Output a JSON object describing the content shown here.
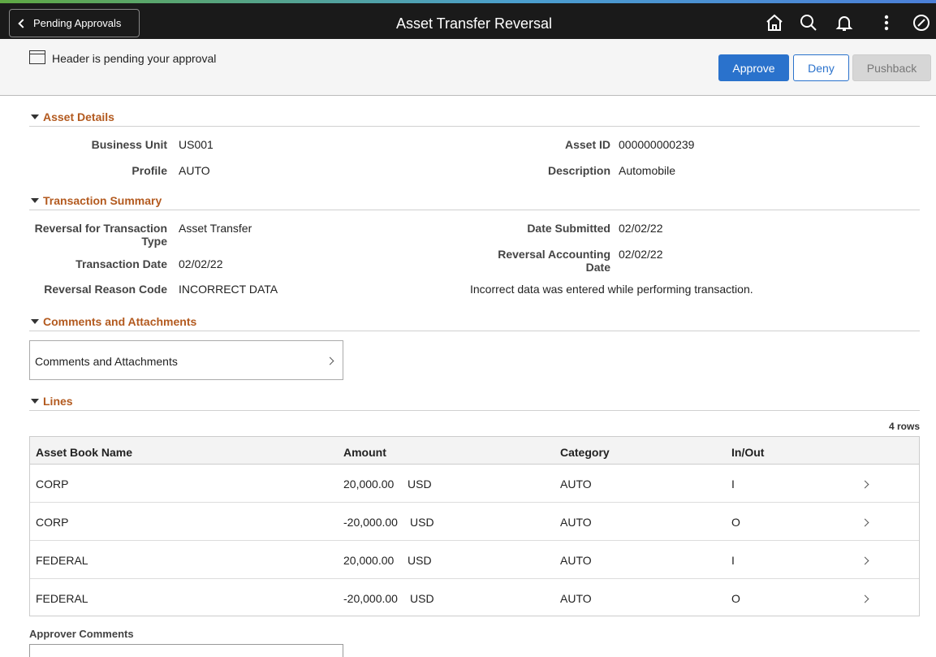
{
  "header": {
    "back_label": "Pending Approvals",
    "title": "Asset Transfer Reversal",
    "icons": [
      "home-icon",
      "search-icon",
      "bell-icon",
      "more-vertical-icon",
      "nav-compass-icon"
    ]
  },
  "subheader": {
    "pending_text": "Header is pending your approval",
    "approve_label": "Approve",
    "deny_label": "Deny",
    "pushback_label": "Pushback"
  },
  "asset_details": {
    "title": "Asset Details",
    "business_unit_label": "Business Unit",
    "business_unit": "US001",
    "asset_id_label": "Asset ID",
    "asset_id": "000000000239",
    "profile_label": "Profile",
    "profile": "AUTO",
    "description_label": "Description",
    "description": "Automobile"
  },
  "transaction_summary": {
    "title": "Transaction Summary",
    "reversal_type_label_1": "Reversal for Transaction",
    "reversal_type_label_2": "Type",
    "reversal_type": "Asset Transfer",
    "date_submitted_label": "Date Submitted",
    "date_submitted": "02/02/22",
    "transaction_date_label": "Transaction Date",
    "transaction_date": "02/02/22",
    "reversal_acct_date_label_1": "Reversal Accounting",
    "reversal_acct_date_label_2": "Date",
    "reversal_acct_date": "02/02/22",
    "reason_code_label": "Reversal Reason Code",
    "reason_code": "INCORRECT DATA",
    "reason_description": "Incorrect data was entered while performing transaction."
  },
  "comments": {
    "title": "Comments and Attachments",
    "link_label": "Comments and Attachments"
  },
  "lines": {
    "title": "Lines",
    "row_count": "4 rows",
    "columns": [
      "Asset Book Name",
      "Amount",
      "Category",
      "In/Out"
    ],
    "rows": [
      {
        "book": "CORP",
        "amount": "20,000.00",
        "currency": "USD",
        "category": "AUTO",
        "inout": "I"
      },
      {
        "book": "CORP",
        "amount": "-20,000.00",
        "currency": "USD",
        "category": "AUTO",
        "inout": "O"
      },
      {
        "book": "FEDERAL",
        "amount": "20,000.00",
        "currency": "USD",
        "category": "AUTO",
        "inout": "I"
      },
      {
        "book": "FEDERAL",
        "amount": "-20,000.00",
        "currency": "USD",
        "category": "AUTO",
        "inout": "O"
      }
    ]
  },
  "approver": {
    "label": "Approver Comments",
    "value": ""
  }
}
